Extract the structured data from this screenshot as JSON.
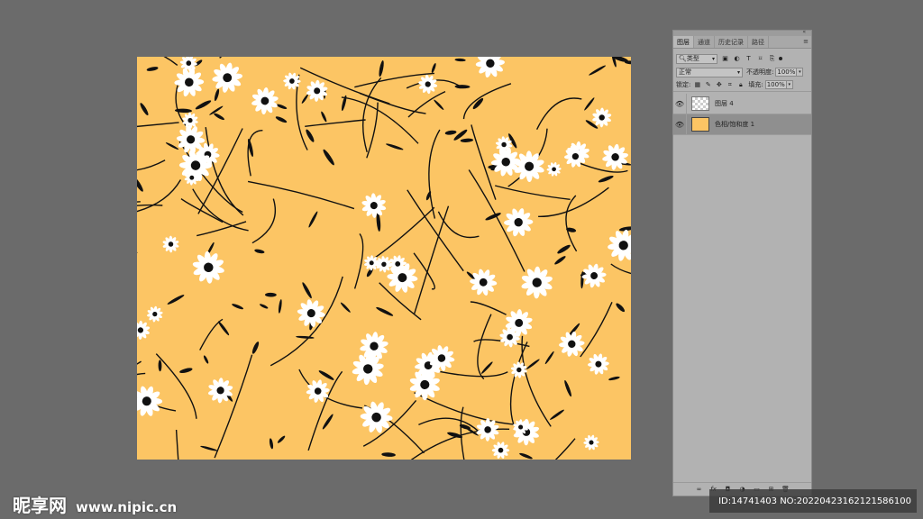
{
  "canvas": {
    "background": "#fcc564",
    "flower_color": "#ffffff",
    "stem_color": "#111111"
  },
  "layers_panel": {
    "collapse_icon": "«",
    "tabs": [
      {
        "label": "图层",
        "active": true
      },
      {
        "label": "通道",
        "active": false
      },
      {
        "label": "历史记录",
        "active": false
      },
      {
        "label": "路径",
        "active": false
      }
    ],
    "menu_icon": "≡",
    "filter": {
      "value": "类型",
      "prefix_icon": "search-icon"
    },
    "blend_mode": "正常",
    "opacity_label": "不透明度:",
    "opacity_value": "100%",
    "lock_label": "锁定:",
    "fill_label": "填充:",
    "fill_value": "100%",
    "layers": [
      {
        "name": "图层 4",
        "thumbnail": "transparent",
        "visible": true,
        "selected": false
      },
      {
        "name": "色相/饱和度 1",
        "thumbnail": "#fcc564",
        "visible": true,
        "selected": true
      }
    ]
  },
  "watermark": {
    "logo": "昵享网",
    "url": "www.nipic.cn",
    "id_text": "ID:14741403 NO:20220423162121586100"
  }
}
